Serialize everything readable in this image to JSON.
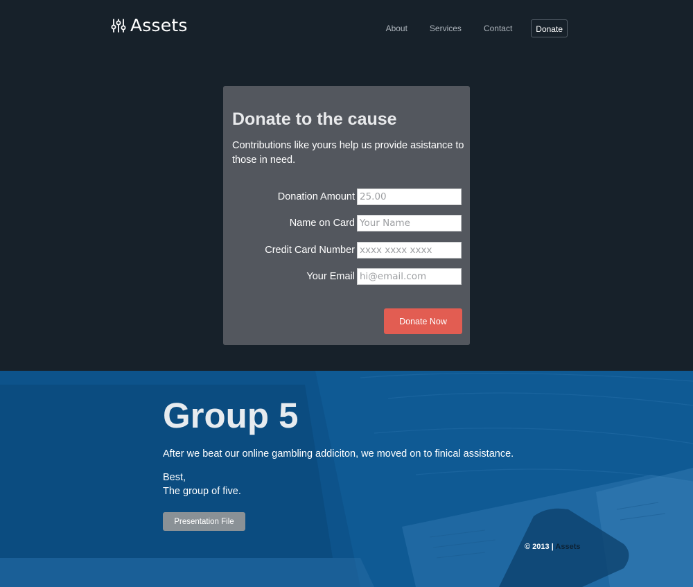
{
  "header": {
    "logo_text": "Assets",
    "logo_icon": "equalizer-sliders-icon",
    "nav": {
      "about": "About",
      "services": "Services",
      "contact": "Contact",
      "donate": "Donate"
    }
  },
  "donation": {
    "title": "Donate to the cause",
    "description": "Contributions like yours help us provide asistance to those in need.",
    "fields": [
      {
        "label": "Donation Amount",
        "placeholder": "25.00"
      },
      {
        "label": "Name on Card",
        "placeholder": "Your Name"
      },
      {
        "label": "Credit Card Number",
        "placeholder": "xxxx xxxx xxxx"
      },
      {
        "label": "Your Email",
        "placeholder": "hi@email.com"
      }
    ],
    "submit_label": "Donate Now"
  },
  "group": {
    "title": "Group 5",
    "text": "After we beat our online gambling addiciton, we moved on to finical assistance.",
    "sign_line1": "Best,",
    "sign_line2": "The group of five.",
    "button_label": "Presentation File"
  },
  "footer": {
    "copyright": "© 2013 |",
    "brand": "Assets"
  },
  "colors": {
    "page_bg": "#17212a",
    "card_bg": "#53575e",
    "accent_button": "#e25d52",
    "section_blue": "#0f5a94",
    "secondary_button": "#8a9196"
  }
}
